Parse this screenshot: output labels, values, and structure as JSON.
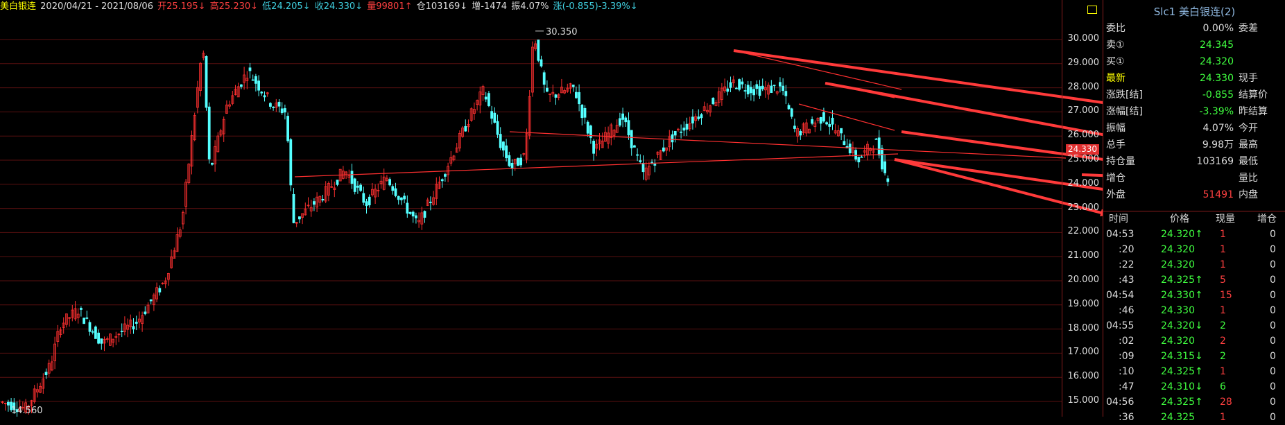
{
  "header": {
    "name": "美白银连",
    "range": "2020/04/21 - 2021/08/06",
    "open": "开25.195↓",
    "high": "高25.230↓",
    "low": "低24.205↓",
    "close": "收24.330↓",
    "volume": "量99801↑",
    "position": "仓103169↓",
    "change_oi": "增-1474",
    "amplitude": "振4.07%",
    "change": "涨(-0.855)-3.39%↓"
  },
  "chart_data": {
    "type": "candlestick",
    "ylim": [
      14.3,
      30.9
    ],
    "y_ticks": [
      "30.000",
      "29.000",
      "28.000",
      "27.000",
      "26.000",
      "25.000",
      "24.000",
      "23.000",
      "22.000",
      "21.000",
      "20.000",
      "19.000",
      "18.000",
      "17.000",
      "16.000",
      "15.000"
    ],
    "y_tick_values": [
      30,
      29,
      28,
      27,
      26,
      25,
      24,
      23,
      22,
      21,
      20,
      19,
      18,
      17,
      16,
      15
    ],
    "annotations": [
      {
        "text": "30.350",
        "value": 30.35
      },
      {
        "text": "14.560",
        "value": 14.56
      }
    ],
    "last_price": "24.330",
    "anchors": [
      [
        0,
        15.0
      ],
      [
        40,
        14.7
      ],
      [
        75,
        16.5
      ],
      [
        90,
        18.2
      ],
      [
        115,
        18.8
      ],
      [
        150,
        17.4
      ],
      [
        200,
        18.3
      ],
      [
        240,
        20.0
      ],
      [
        265,
        22.5
      ],
      [
        295,
        29.8
      ],
      [
        305,
        24.5
      ],
      [
        330,
        27.3
      ],
      [
        360,
        28.7
      ],
      [
        395,
        27.3
      ],
      [
        415,
        27.0
      ],
      [
        425,
        22.4
      ],
      [
        470,
        23.6
      ],
      [
        500,
        24.6
      ],
      [
        530,
        23.2
      ],
      [
        560,
        24.3
      ],
      [
        605,
        22.3
      ],
      [
        640,
        24.3
      ],
      [
        680,
        26.8
      ],
      [
        700,
        27.9
      ],
      [
        725,
        25.6
      ],
      [
        740,
        24.7
      ],
      [
        760,
        25.2
      ],
      [
        772,
        30.35
      ],
      [
        790,
        27.6
      ],
      [
        830,
        28.0
      ],
      [
        860,
        25.4
      ],
      [
        900,
        26.8
      ],
      [
        930,
        24.4
      ],
      [
        970,
        25.9
      ],
      [
        1010,
        26.9
      ],
      [
        1060,
        28.2
      ],
      [
        1090,
        27.9
      ],
      [
        1130,
        28.0
      ],
      [
        1150,
        26.1
      ],
      [
        1190,
        26.8
      ],
      [
        1220,
        25.8
      ],
      [
        1240,
        25.0
      ],
      [
        1265,
        25.8
      ],
      [
        1280,
        24.33
      ]
    ]
  },
  "panel": {
    "title": "Slc1 美白银连(2)",
    "rows": [
      {
        "k": "委比",
        "v": "0.00%",
        "k2": "委差",
        "vc": "#ddd"
      },
      {
        "k": "卖①",
        "v": "24.345",
        "k2": "",
        "vc": "#40ff40"
      },
      {
        "k": "买①",
        "v": "24.320",
        "k2": "",
        "vc": "#40ff40"
      },
      {
        "k": "最新",
        "v": "24.330",
        "k2": "现手",
        "vc": "#40ff40"
      },
      {
        "k": "涨跌[结]",
        "v": "-0.855",
        "k2": "结算价",
        "vc": "#40ff40"
      },
      {
        "k": "涨幅[结]",
        "v": "-3.39%",
        "k2": "昨结算",
        "vc": "#40ff40"
      },
      {
        "k": "振幅",
        "v": "4.07%",
        "k2": "今开",
        "vc": "#ddd"
      },
      {
        "k": "总手",
        "v": "9.98万",
        "k2": "最高",
        "vc": "#ddd"
      },
      {
        "k": "持仓量",
        "v": "103169",
        "k2": "最低",
        "vc": "#ddd"
      },
      {
        "k": "增仓",
        "v": "",
        "k2": "量比",
        "vc": "#ddd"
      },
      {
        "k": "外盘",
        "v": "51491",
        "k2": "内盘",
        "vc": "#ff4040"
      }
    ],
    "tick_header": {
      "time": "时间",
      "price": "价格",
      "vol": "现量",
      "oi": "增仓"
    },
    "ticks": [
      {
        "t": "04:53",
        "p": "24.320↑",
        "v": "1",
        "o": "0"
      },
      {
        "t": ":20",
        "p": "24.320",
        "v": "1",
        "o": "0"
      },
      {
        "t": ":22",
        "p": "24.320",
        "v": "1",
        "o": "0"
      },
      {
        "t": ":43",
        "p": "24.325↑",
        "v": "5",
        "o": "0"
      },
      {
        "t": "04:54",
        "p": "24.330↑",
        "v": "15",
        "o": "0"
      },
      {
        "t": ":46",
        "p": "24.330",
        "v": "1",
        "o": "0"
      },
      {
        "t": "04:55",
        "p": "24.320↓",
        "v": "2",
        "o": "0"
      },
      {
        "t": ":02",
        "p": "24.320",
        "v": "2",
        "o": "0"
      },
      {
        "t": ":09",
        "p": "24.315↓",
        "v": "2",
        "o": "0"
      },
      {
        "t": ":10",
        "p": "24.325↑",
        "v": "1",
        "o": "0"
      },
      {
        "t": ":47",
        "p": "24.310↓",
        "v": "6",
        "o": "0"
      },
      {
        "t": "04:56",
        "p": "24.325↑",
        "v": "28",
        "o": "0"
      },
      {
        "t": ":36",
        "p": "24.325",
        "v": "1",
        "o": "0"
      }
    ]
  }
}
